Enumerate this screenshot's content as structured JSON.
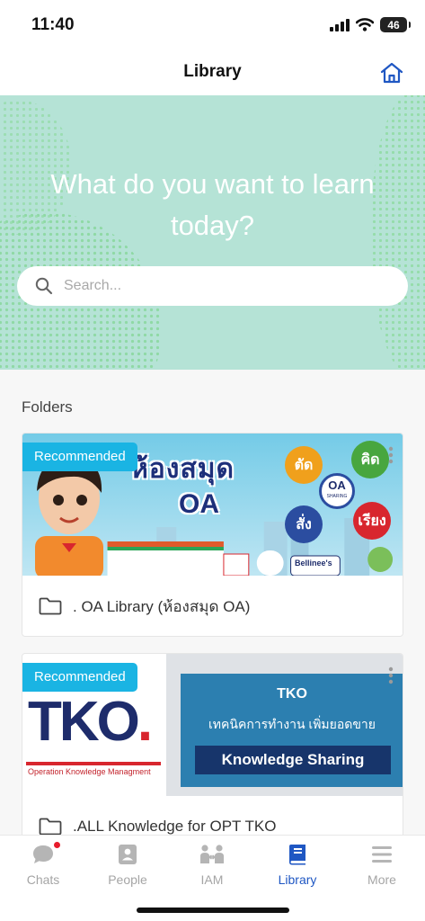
{
  "status_bar": {
    "time": "11:40",
    "battery": "46"
  },
  "header": {
    "title": "Library"
  },
  "hero": {
    "heading": "What do you want to learn today?",
    "search_placeholder": "Search..."
  },
  "folders": {
    "section_label": "Folders",
    "items": [
      {
        "badge": "Recommended",
        "title": ". OA Library (ห้องสมุด OA)",
        "banner": {
          "title": "ห้องสมุด",
          "subtitle": "OA",
          "words": [
            "ตัด",
            "คิด",
            "สั่ง",
            "เรียง"
          ],
          "center_logo": "OA",
          "center_logo_caption": "SHARING",
          "shop_label": "Bellinee's"
        }
      },
      {
        "badge": "Recommended",
        "title": ".ALL Knowledge for OPT TKO",
        "banner": {
          "logo": "TKO",
          "logo_dot": ".",
          "logo_sub": "Operation Knowledge Managment",
          "panel_title": "TKO",
          "panel_thai": "เทคนิคการทำงาน เพิ่มยอดขาย",
          "panel_label": "Knowledge Sharing"
        }
      }
    ]
  },
  "tabs": [
    {
      "label": "Chats",
      "icon": "chat-bubble-icon",
      "active": false,
      "has_notification": true
    },
    {
      "label": "People",
      "icon": "contact-card-icon",
      "active": false
    },
    {
      "label": "IAM",
      "icon": "people-connect-icon",
      "active": false
    },
    {
      "label": "Library",
      "icon": "book-icon",
      "active": true
    },
    {
      "label": "More",
      "icon": "menu-lines-icon",
      "active": false
    }
  ],
  "colors": {
    "accent": "#1f57c3",
    "hero_bg": "#b5e3d6",
    "badge": "#1ab4e3",
    "notification": "#e81c2c"
  }
}
